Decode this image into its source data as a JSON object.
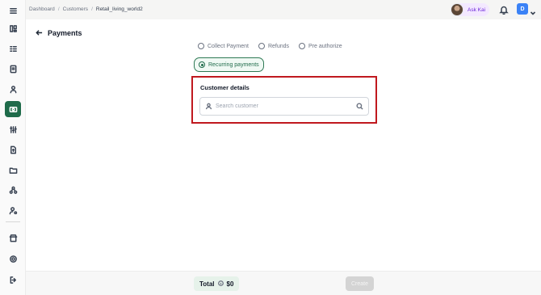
{
  "breadcrumb": [
    "Dashboard",
    "Customers",
    "Retail_living_world2"
  ],
  "topbar": {
    "ask_label": "Ask Kai",
    "user_initial": "D"
  },
  "page": {
    "title": "Payments"
  },
  "payment_types": [
    {
      "label": "Collect Payment",
      "selected": false
    },
    {
      "label": "Refunds",
      "selected": false
    },
    {
      "label": "Pre authorize",
      "selected": false
    },
    {
      "label": "Recurring payments",
      "selected": true
    }
  ],
  "customer": {
    "heading": "Customer details",
    "search_placeholder": "Search customer",
    "search_value": ""
  },
  "footer": {
    "total_label": "Total",
    "total_value": "$0",
    "create_label": "Create"
  },
  "colors": {
    "accent": "#1f6b4a",
    "highlight": "#c0191f",
    "ask_kai_bg": "#f3e8ff",
    "avatar": "#3b82f6"
  },
  "sidebar_icons": [
    "menu-icon",
    "dashboard-icon",
    "list-icon",
    "document-icon",
    "user-icon",
    "payments-icon",
    "sliders-icon",
    "file-dollar-icon",
    "folder-icon",
    "network-icon",
    "user-settings-icon",
    "store-icon",
    "gear-icon",
    "logout-icon"
  ]
}
